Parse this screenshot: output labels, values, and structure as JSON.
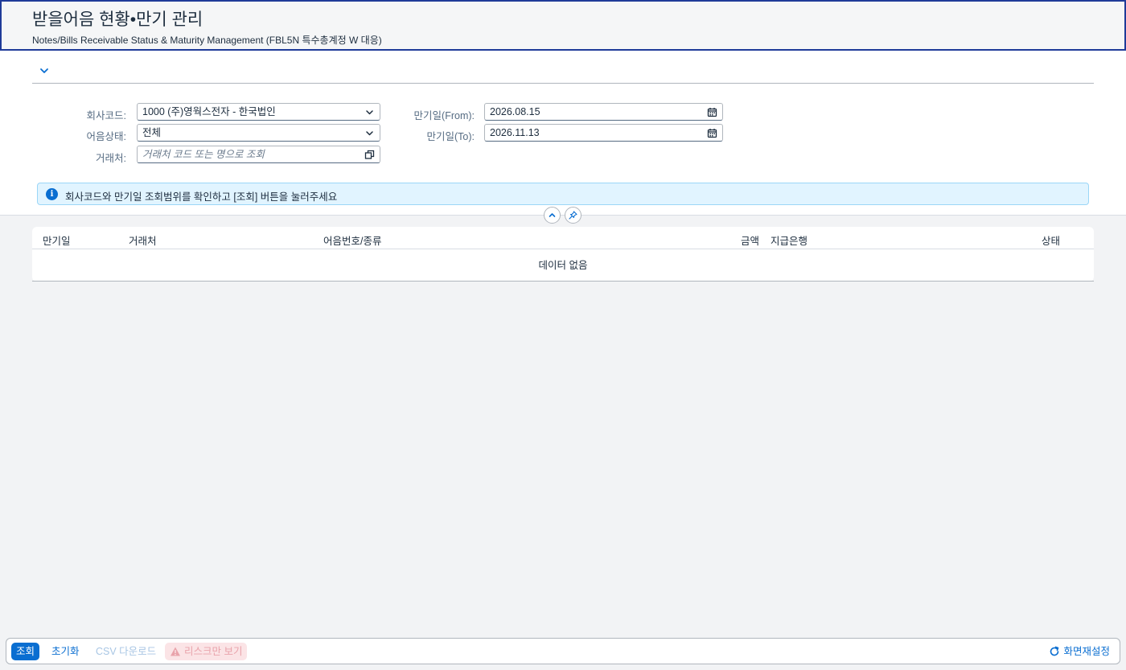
{
  "header": {
    "title": "받을어음 현황•만기 관리",
    "subtitle": "Notes/Bills Receivable Status & Maturity Management (FBL5N 특수총계정 W 대응)"
  },
  "filters": {
    "company_code": {
      "label": "회사코드:",
      "value": "1000 (주)영웍스전자 - 한국법인"
    },
    "note_status": {
      "label": "어음상태:",
      "value": "전체"
    },
    "customer": {
      "label": "거래처:",
      "placeholder": "거래처 코드 또는 명으로 조회"
    },
    "due_from": {
      "label": "만기일(From):",
      "value": "2026.08.15"
    },
    "due_to": {
      "label": "만기일(To):",
      "value": "2026.11.13"
    }
  },
  "info_message": "회사코드와 만기일 조회범위를 확인하고 [조회] 버튼을 눌러주세요",
  "table": {
    "columns": [
      "만기일",
      "거래처",
      "어음번호/종류",
      "금액",
      "지급은행",
      "상태"
    ],
    "no_data": "데이터 없음"
  },
  "footer": {
    "search": "조회",
    "reset": "초기화",
    "csv": "CSV 다운로드",
    "risk_only": "리스크만 보기",
    "reset_view": "화면재설정"
  },
  "colors": {
    "accent": "#0a6ed1",
    "header_border": "#1f3b99",
    "info_bg": "#e1f4ff",
    "risk_bg": "#fbe4e6"
  },
  "icons": {
    "expand": "chevron-down-icon",
    "dropdown": "chevron-down-icon",
    "calendar": "calendar-icon",
    "value_help": "value-help-icon",
    "info": "info-icon",
    "collapse": "chevron-up-icon",
    "pin": "pin-icon",
    "warning": "warning-icon",
    "refresh": "refresh-icon"
  }
}
